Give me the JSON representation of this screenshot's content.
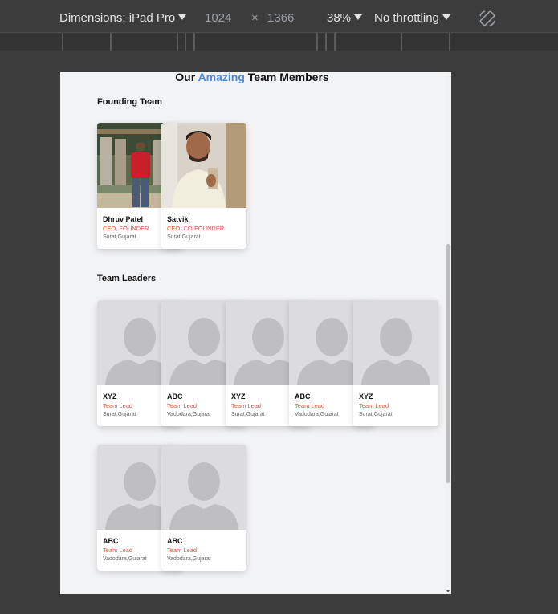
{
  "devtools": {
    "device_label": "Dimensions: iPad Pro",
    "width": "1024",
    "times": "×",
    "height": "1366",
    "zoom": "38%",
    "throttling": "No throttling"
  },
  "page": {
    "title_before": "Our",
    "title_accent": "Amazing",
    "title_after": "Team Members",
    "accent_color": "#4a89dc",
    "role_color": "#e4533a"
  },
  "sections": {
    "founding": {
      "title": "Founding Team",
      "members": [
        {
          "name": "Dhruv Patel",
          "role": "CEO, FOUNDER",
          "location": "Surat,Gujarat",
          "photo": "photo"
        },
        {
          "name": "Satvik",
          "role": "CEO, CO-FOUNDER",
          "location": "Surat,Gujarat",
          "photo": "photo"
        }
      ]
    },
    "leaders": {
      "title": "Team Leaders",
      "members": [
        {
          "name": "XYZ",
          "role": "Team Lead",
          "location": "Surat,Gujarat",
          "photo": "placeholder-avatar-icon"
        },
        {
          "name": "ABC",
          "role": "Team Lead",
          "location": "Vadodara,Gujarat",
          "photo": "placeholder-avatar-icon"
        },
        {
          "name": "XYZ",
          "role": "Team Lead",
          "location": "Surat,Gujarat",
          "photo": "placeholder-avatar-icon"
        },
        {
          "name": "ABC",
          "role": "Team Lead",
          "location": "Vadodara,Gujarat",
          "photo": "placeholder-avatar-icon"
        },
        {
          "name": "XYZ",
          "role": "Team Lead",
          "location": "Surat,Gujarat",
          "photo": "placeholder-avatar-icon"
        },
        {
          "name": "ABC",
          "role": "Team Lead",
          "location": "Vadodara,Gujarat",
          "photo": "placeholder-avatar-icon"
        },
        {
          "name": "ABC",
          "role": "Team Lead",
          "location": "Vadodara,Gujarat",
          "photo": "placeholder-avatar-icon"
        }
      ]
    }
  }
}
